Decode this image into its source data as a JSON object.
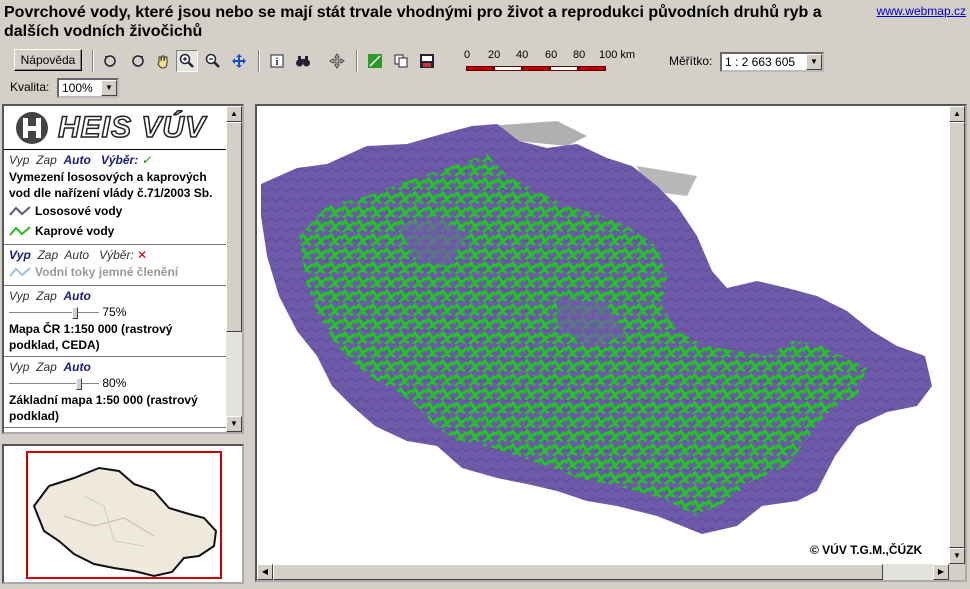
{
  "header": {
    "title": "Povrchové vody, které jsou nebo se mají stát trvale vhodnými pro život a reprodukci původních druhů ryb a dalších vodních živočichů",
    "link": "www.webmap.cz"
  },
  "toolbar": {
    "help_label": "Nápověda",
    "tools": [
      "zoom-previous-icon",
      "zoom-next-icon",
      "pan-hand-icon",
      "zoom-in-icon",
      "zoom-out-icon",
      "full-extent-icon",
      "info-icon",
      "search-binoculars-icon",
      "move-icon",
      "select-layer-icon",
      "copy-icon",
      "print-icon"
    ],
    "active_tool": "zoom-in-icon",
    "scale_ticks": [
      "0",
      "20",
      "40",
      "60",
      "80",
      "100 km"
    ],
    "scale_label": "Měřítko:",
    "scale_value": "1 : 2 663 605",
    "quality_label": "Kvalita:",
    "quality_value": "100%"
  },
  "legend": {
    "logo": "HEIS VÚV",
    "layers": [
      {
        "vyp": "Vyp",
        "zap": "Zap",
        "auto": "Auto",
        "vyber": "Výběr:",
        "vyber_state": "check",
        "active_mode": "Auto",
        "name": "Vymezení lososových a kaprových vod dle nařízení vlády č.71/2003 Sb.",
        "symbols": [
          {
            "label": "Lososové vody",
            "color": "#5a5aa8"
          },
          {
            "label": "Kaprové vody",
            "color": "#22bb22"
          }
        ]
      },
      {
        "vyp": "Vyp",
        "zap": "Zap",
        "auto": "Auto",
        "vyber": "Výběr:",
        "vyber_state": "cross",
        "active_mode": "Vyp",
        "symbols": [
          {
            "label": "Vodní toky jemné členění",
            "color": "#9ac0e0"
          }
        ]
      },
      {
        "vyp": "Vyp",
        "zap": "Zap",
        "auto": "Auto",
        "active_mode": "Auto",
        "opacity": "75%",
        "opacity_value": 0.75,
        "name": "Mapa ČR 1:150 000 (rastrový podklad, CEDA)"
      },
      {
        "vyp": "Vyp",
        "zap": "Zap",
        "auto": "Auto",
        "active_mode": "Auto",
        "opacity": "80%",
        "opacity_value": 0.8,
        "name": "Základní mapa 1:50 000 (rastrový podklad)"
      }
    ]
  },
  "map": {
    "copyright": "© VÚV T.G.M.,ČÚZK",
    "colors": {
      "salmon": "#6f5aaa",
      "carp": "#1ec81e",
      "relief": "#a8a8a8"
    }
  }
}
